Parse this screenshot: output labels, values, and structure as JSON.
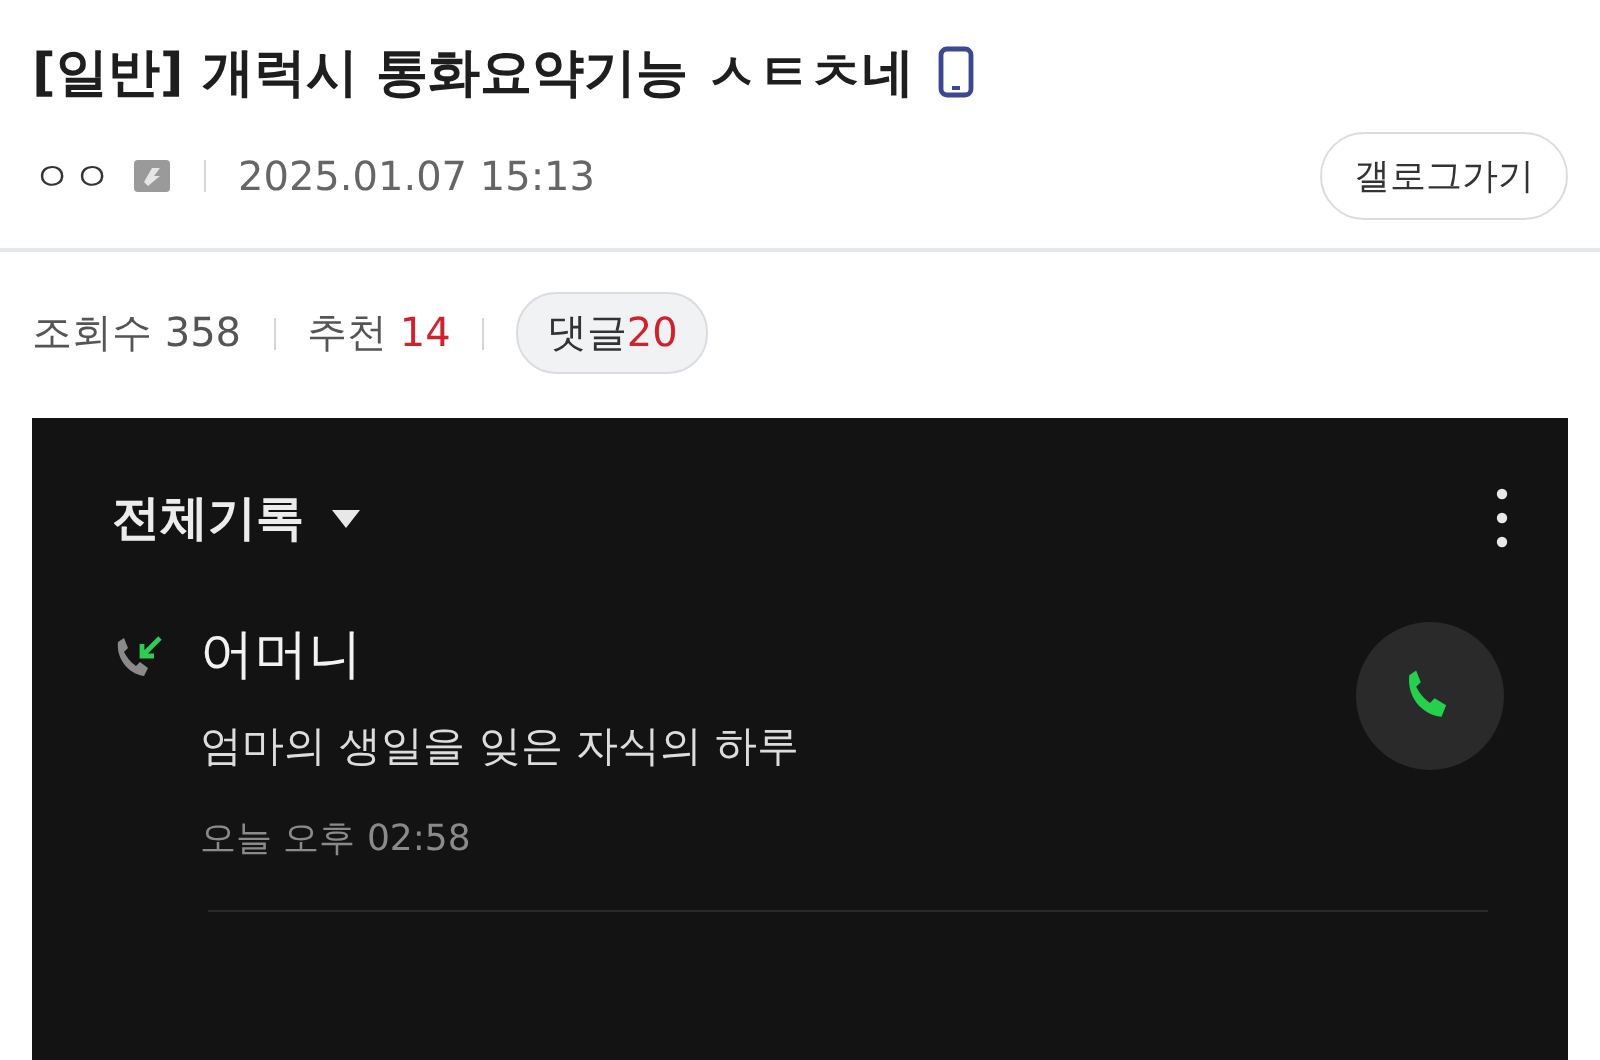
{
  "post": {
    "title": "[일반] 개럭시 통화요약기능 ㅅㅌㅊ네",
    "author": "ㅇㅇ",
    "date": "2025.01.07 15:13",
    "gallery_button": "갤로그가기"
  },
  "stats": [
    {
      "kind": "plain",
      "label": "조회수",
      "value": "358",
      "highlight": false
    },
    {
      "kind": "plain",
      "label": "추천",
      "value": "14",
      "highlight": true
    },
    {
      "kind": "pill",
      "label": "댓글",
      "value": "20",
      "highlight": true
    }
  ],
  "call_log": {
    "filter": "전체기록",
    "entries": [
      {
        "name": "어머니",
        "summary": "엄마의 생일을 잊은 자식의 하루",
        "time": "오늘 오후 02:58"
      }
    ]
  }
}
